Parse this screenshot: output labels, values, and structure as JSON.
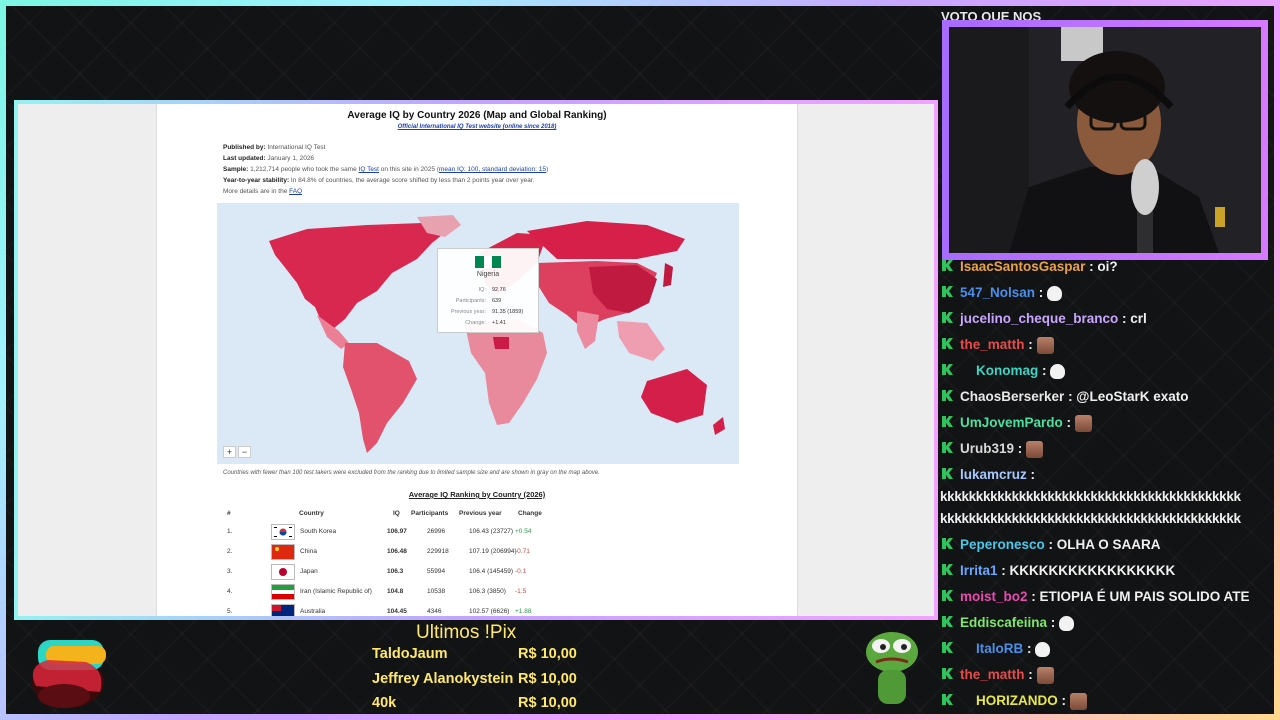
{
  "browser_page": {
    "title": "Average IQ by Country 2026 (Map and Global Ranking)",
    "subtitle_link": "Official International IQ Test website (online since 2018)",
    "meta": [
      {
        "label": "Published by:",
        "text": " International IQ Test"
      },
      {
        "label": "Last updated:",
        "text": " January 1, 2026"
      },
      {
        "label": "Sample:",
        "text": " 1,212,714 people who took the same ",
        "link1": "IQ Test",
        "text2": " on this site in 2025 (",
        "link2": "mean IQ: 100, standard deviation: 15",
        "text3": ")"
      },
      {
        "label": "Year-to-year stability:",
        "text": " In 84.8% of countries, the average score shifted by less than 2 points year over year."
      },
      {
        "label": "",
        "text": "More details are in the ",
        "link1": "FAQ"
      }
    ],
    "tooltip": {
      "country": "Nigeria",
      "rows": [
        {
          "key": "IQ:",
          "value": "92.76"
        },
        {
          "key": "Participants:",
          "value": "639"
        },
        {
          "key": "Previous year:",
          "value": "91.35 (1859)"
        },
        {
          "key": "Change:",
          "value": "+1.41"
        }
      ]
    },
    "zoom_in": "+",
    "zoom_out": "−",
    "note": "Countries with fewer than 100 test takers were excluded from the ranking due to limited sample size and are shown in gray on the map above.",
    "ranking_title": "Average IQ Ranking by Country (2026)",
    "columns": {
      "num": "#",
      "country": "Country",
      "iq": "IQ",
      "participants": "Participants",
      "previous": "Previous year",
      "change": "Change"
    },
    "rows": [
      {
        "num": "1.",
        "country": "South Korea",
        "iq": "106.97",
        "participants": "26996",
        "previous": "106.43 (23727)",
        "change": "+0.54",
        "trend": "pos"
      },
      {
        "num": "2.",
        "country": "China",
        "iq": "106.48",
        "participants": "229918",
        "previous": "107.19 (206994)",
        "change": "-0.71",
        "trend": "neg"
      },
      {
        "num": "3.",
        "country": "Japan",
        "iq": "106.3",
        "participants": "55994",
        "previous": "106.4 (145459)",
        "change": "-0.1",
        "trend": "neg"
      },
      {
        "num": "4.",
        "country": "Iran (Islamic Republic of)",
        "iq": "104.8",
        "participants": "10538",
        "previous": "106.3 (3850)",
        "change": "-1.5",
        "trend": "neg"
      },
      {
        "num": "5.",
        "country": "Australia",
        "iq": "104.45",
        "participants": "4346",
        "previous": "102.57 (6626)",
        "change": "+1.88",
        "trend": "pos"
      }
    ]
  },
  "overlay": {
    "vote_text": "VOTO QUE NOS",
    "pix_title": "Ultimos !Pix",
    "pix": [
      {
        "name": "TaldoJaum",
        "amount": "R$ 10,00"
      },
      {
        "name": "Jeffrey Alanokystein",
        "amount": "R$ 10,00"
      },
      {
        "name": "40k",
        "amount": "R$ 10,00"
      }
    ]
  },
  "chat": [
    {
      "user": "IsaacSantosGaspar",
      "color": "#e8a24a",
      "text": " : oi?",
      "emote": ""
    },
    {
      "user": "547_Nolsan",
      "color": "#4a8fe8",
      "text": " : ",
      "emote": "ghost"
    },
    {
      "user": "jucelino_cheque_branco",
      "color": "#c9a6ff",
      "text": " : crl",
      "emote": ""
    },
    {
      "user": "the_matth",
      "color": "#e84a4a",
      "text": " : ",
      "emote": "face"
    },
    {
      "user": "Konomag",
      "color": "#3fd4c4",
      "text": " : ",
      "emote": "ghost"
    },
    {
      "user": "ChaosBerserker",
      "color": "#e8e8e8",
      "text": " : @LeoStarK exato",
      "emote": ""
    },
    {
      "user": "UmJovemPardo",
      "color": "#4ae0a0",
      "text": " : ",
      "emote": "face"
    },
    {
      "user": "Urub319",
      "color": "#d8d8d8",
      "text": " : ",
      "emote": "face"
    },
    {
      "user": "lukamcruz",
      "color": "#a6c8ff",
      "text": " :",
      "emote": ""
    },
    {
      "user": "Peperonesco",
      "color": "#4ac8e8",
      "text": " : OLHA O SAARA",
      "emote": ""
    },
    {
      "user": "Irrita1",
      "color": "#6aa8ff",
      "text": " : KKKKKKKKKKKKKKKKK",
      "emote": ""
    },
    {
      "user": "moist_bo2",
      "color": "#e84ab0",
      "text": " : ETIOPIA É UM PAIS SOLIDO ATE",
      "emote": ""
    },
    {
      "user": "Eddiscafeiina",
      "color": "#7ee86a",
      "text": " : ",
      "emote": "ghost"
    },
    {
      "user": "ItaloRB",
      "color": "#4a8fe8",
      "text": " : ",
      "emote": "ghost"
    },
    {
      "user": "the_matth",
      "color": "#e84a4a",
      "text": " : ",
      "emote": "face"
    },
    {
      "user": "HORIZANDO",
      "color": "#e8e84a",
      "text": " : ",
      "emote": "face"
    }
  ],
  "chat_spam": [
    "kkkkkkkkkkkkkkkkkkkkkkkkkkkkkkkkkkkkkkkkkk",
    "kkkkkkkkkkkkkkkkkkkkkkkkkkkkkkkkkkkkkkkkkk"
  ]
}
